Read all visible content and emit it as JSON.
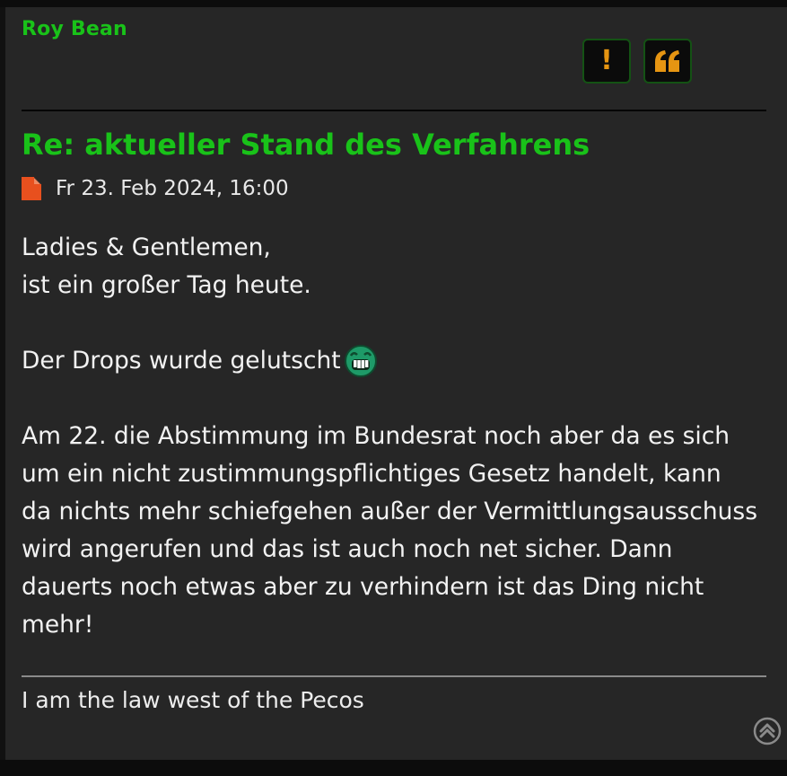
{
  "post": {
    "author": "Roy Bean",
    "title": "Re: aktueller Stand des Verfahrens",
    "date": "Fr 23. Feb 2024, 16:00",
    "body": {
      "line1": "Ladies & Gentlemen,",
      "line2": "ist ein großer Tag heute.",
      "line3": "Der Drops wurde gelutscht",
      "para": [
        "Am 22. die Abstimmung im Bundesrat noch aber da es sich",
        "um ein nicht zustimmungspflichtiges Gesetz handelt, kann",
        "da nichts mehr schiefgehen außer der Vermittlungsausschuss",
        "wird angerufen und das ist auch noch net sicher. Dann",
        "dauerts noch etwas aber zu verhindern ist das Ding nicht",
        "mehr!"
      ]
    },
    "signature": "I am the law west of the Pecos",
    "buttons": {
      "report": "!"
    }
  },
  "icons": {
    "report": "exclamation-icon",
    "quote": "quote-icon",
    "post_file": "file-icon",
    "smiley": "grin-smiley-icon",
    "back_to_top": "chevron-up-circle-icon"
  },
  "colors": {
    "accent": "#19c219",
    "button_icon": "#e69512",
    "post_icon": "#e8501e",
    "background": "#262626"
  }
}
